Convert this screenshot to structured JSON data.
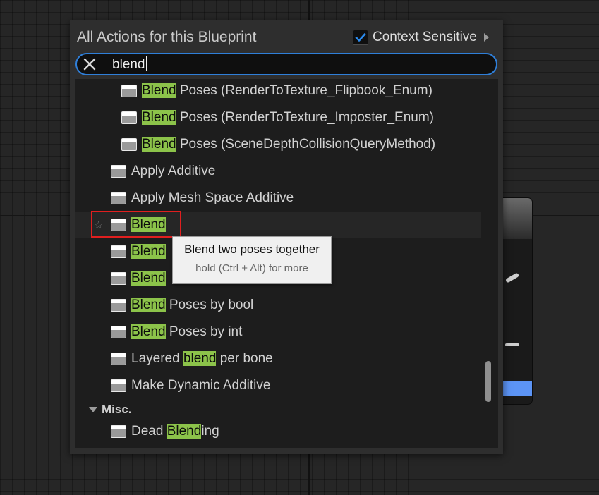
{
  "menu": {
    "title": "All Actions for this Blueprint",
    "context_sensitive": {
      "label": "Context Sensitive",
      "checked": true
    }
  },
  "search": {
    "value": "blend"
  },
  "results": [
    {
      "pre": "",
      "hl": "Blend",
      "post": " Poses (RenderToTexture_Flipbook_Enum)"
    },
    {
      "pre": "",
      "hl": "Blend",
      "post": " Poses (RenderToTexture_Imposter_Enum)"
    },
    {
      "pre": "",
      "hl": "Blend",
      "post": " Poses (SceneDepthCollisionQueryMethod)"
    },
    {
      "pre": "Apply Additive",
      "hl": "",
      "post": ""
    },
    {
      "pre": "Apply Mesh Space Additive",
      "hl": "",
      "post": ""
    },
    {
      "pre": "",
      "hl": "Blend",
      "post": ""
    },
    {
      "pre": "",
      "hl": "Blend",
      "post": ""
    },
    {
      "pre": "",
      "hl": "Blend",
      "post": ""
    },
    {
      "pre": "",
      "hl": "Blend",
      "post": " Poses by bool"
    },
    {
      "pre": "",
      "hl": "Blend",
      "post": " Poses by int"
    },
    {
      "pre": "Layered ",
      "hl": "blend",
      "post": " per bone"
    },
    {
      "pre": "Make Dynamic Additive",
      "hl": "",
      "post": ""
    },
    {
      "pre": "Dead ",
      "hl": "Blend",
      "post": "ing"
    }
  ],
  "categories": {
    "misc": "Misc."
  },
  "tooltip": {
    "title": "Blend two poses together",
    "hint": "hold (Ctrl + Alt) for more"
  },
  "icons": {
    "clear": "close-icon",
    "check": "checkmark-icon",
    "node": "node-icon",
    "favorite": "star-outline-icon"
  },
  "colors": {
    "highlight": "#8cc34a",
    "search_border": "#2f7fd9",
    "selection_box": "#e01f1f"
  }
}
